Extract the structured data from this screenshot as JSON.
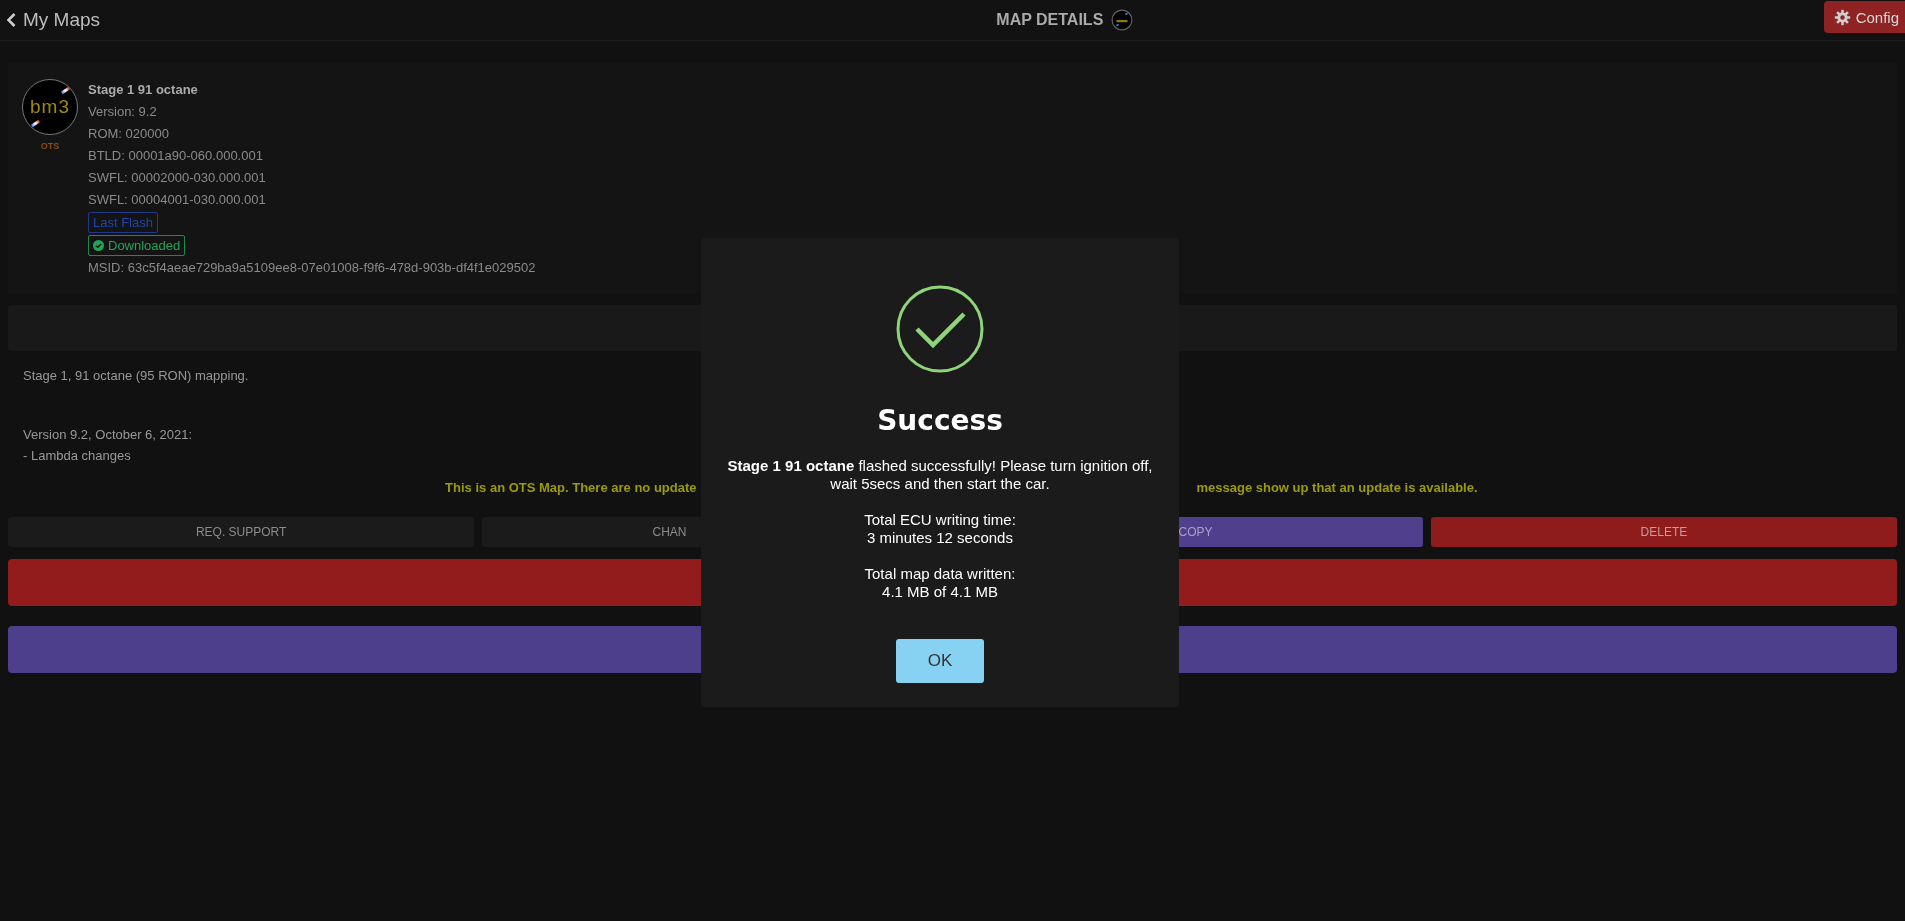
{
  "header": {
    "back_label": "My Maps",
    "title": "MAP DETAILS",
    "config_label": "Config"
  },
  "map": {
    "logo_text": "bm3",
    "logo_tag": "OTS",
    "name": "Stage 1 91 octane",
    "details": [
      "Version: 9.2",
      "ROM: 020000",
      "BTLD: 00001a90-060.000.001",
      "SWFL: 00002000-030.000.001",
      "SWFL: 00004001-030.000.001"
    ],
    "badges": [
      {
        "kind": "info",
        "label": "Last Flash"
      },
      {
        "kind": "success",
        "label": "Downloaded"
      }
    ],
    "msid": "MSID: 63c5f4aeae729ba9a5109ee8-07e01008-f9f6-478d-903b-df4f1e029502"
  },
  "description": [
    "Stage 1, 91 octane (95 RON) mapping.",
    "Version 9.2, October 6, 2021:",
    "- Lambda changes"
  ],
  "notice": {
    "left": "This is an OTS Map. There are no update",
    "right": "message show up that an update is available."
  },
  "actions": [
    {
      "kind": "plain",
      "label": "REQ. SUPPORT"
    },
    {
      "kind": "plain",
      "label": "CHAN"
    },
    {
      "kind": "purple",
      "label": "COPY"
    },
    {
      "kind": "red",
      "label": "DELETE"
    }
  ],
  "bars": [
    {
      "kind": "red"
    },
    {
      "kind": "purple"
    }
  ],
  "dialog": {
    "title": "Success",
    "message": "**Stage 1 91 octane** flashed successfully! Please turn ignition off, wait 5secs and then start the car.",
    "stats": [
      [
        "Total ECU writing time:",
        "3 minutes 12 seconds"
      ],
      [
        "Total map data written:",
        "4.1 MB of 4.1 MB"
      ]
    ],
    "button": "OK"
  }
}
